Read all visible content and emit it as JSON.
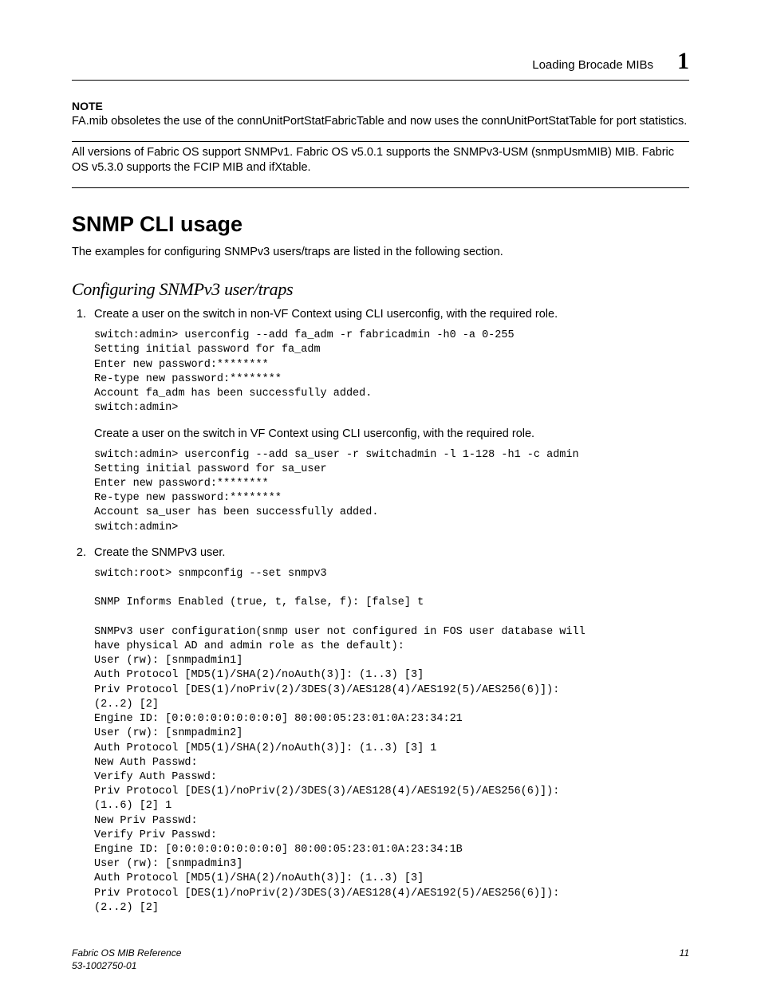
{
  "header": {
    "section_title": "Loading Brocade MIBs",
    "chapter_number": "1"
  },
  "note": {
    "label": "NOTE",
    "text": "FA.mib obsoletes the use of the connUnitPortStatFabricTable and now uses the connUnitPortStatTable for port statistics."
  },
  "intro_para": "All versions of Fabric OS support SNMPv1. Fabric OS v5.0.1 supports the SNMPv3-USM (snmpUsmMIB) MIB. Fabric OS v5.3.0 supports the FCIP MIB and ifXtable.",
  "section_heading": "SNMP CLI usage",
  "section_intro": "The examples for configuring SNMPv3 users/traps are listed in the following section.",
  "subsection_heading": "Configuring SNMPv3 user/traps",
  "steps": {
    "s1": {
      "text": "Create a user on the switch in non-VF Context using CLI userconfig, with the required role.",
      "code1": "switch:admin> userconfig --add fa_adm -r fabricadmin -h0 -a 0-255\nSetting initial password for fa_adm\nEnter new password:********\nRe-type new password:********\nAccount fa_adm has been successfully added.\nswitch:admin>",
      "sub_text": "Create a user on the switch in VF Context using CLI userconfig, with the required role.",
      "code2": "switch:admin> userconfig --add sa_user -r switchadmin -l 1-128 -h1 -c admin\nSetting initial password for sa_user\nEnter new password:********\nRe-type new password:********\nAccount sa_user has been successfully added.\nswitch:admin>"
    },
    "s2": {
      "text": "Create the SNMPv3 user.",
      "code": "switch:root> snmpconfig --set snmpv3\n\nSNMP Informs Enabled (true, t, false, f): [false] t\n\nSNMPv3 user configuration(snmp user not configured in FOS user database will\nhave physical AD and admin role as the default):\nUser (rw): [snmpadmin1]\nAuth Protocol [MD5(1)/SHA(2)/noAuth(3)]: (1..3) [3]\nPriv Protocol [DES(1)/noPriv(2)/3DES(3)/AES128(4)/AES192(5)/AES256(6)]):\n(2..2) [2]\nEngine ID: [0:0:0:0:0:0:0:0:0] 80:00:05:23:01:0A:23:34:21\nUser (rw): [snmpadmin2]\nAuth Protocol [MD5(1)/SHA(2)/noAuth(3)]: (1..3) [3] 1\nNew Auth Passwd:\nVerify Auth Passwd:\nPriv Protocol [DES(1)/noPriv(2)/3DES(3)/AES128(4)/AES192(5)/AES256(6)]):\n(1..6) [2] 1\nNew Priv Passwd:\nVerify Priv Passwd:\nEngine ID: [0:0:0:0:0:0:0:0:0] 80:00:05:23:01:0A:23:34:1B\nUser (rw): [snmpadmin3]\nAuth Protocol [MD5(1)/SHA(2)/noAuth(3)]: (1..3) [3]\nPriv Protocol [DES(1)/noPriv(2)/3DES(3)/AES128(4)/AES192(5)/AES256(6)]):\n(2..2) [2]"
    }
  },
  "footer": {
    "doc_title": "Fabric OS MIB Reference",
    "doc_id": "53-1002750-01",
    "page_number": "11"
  }
}
